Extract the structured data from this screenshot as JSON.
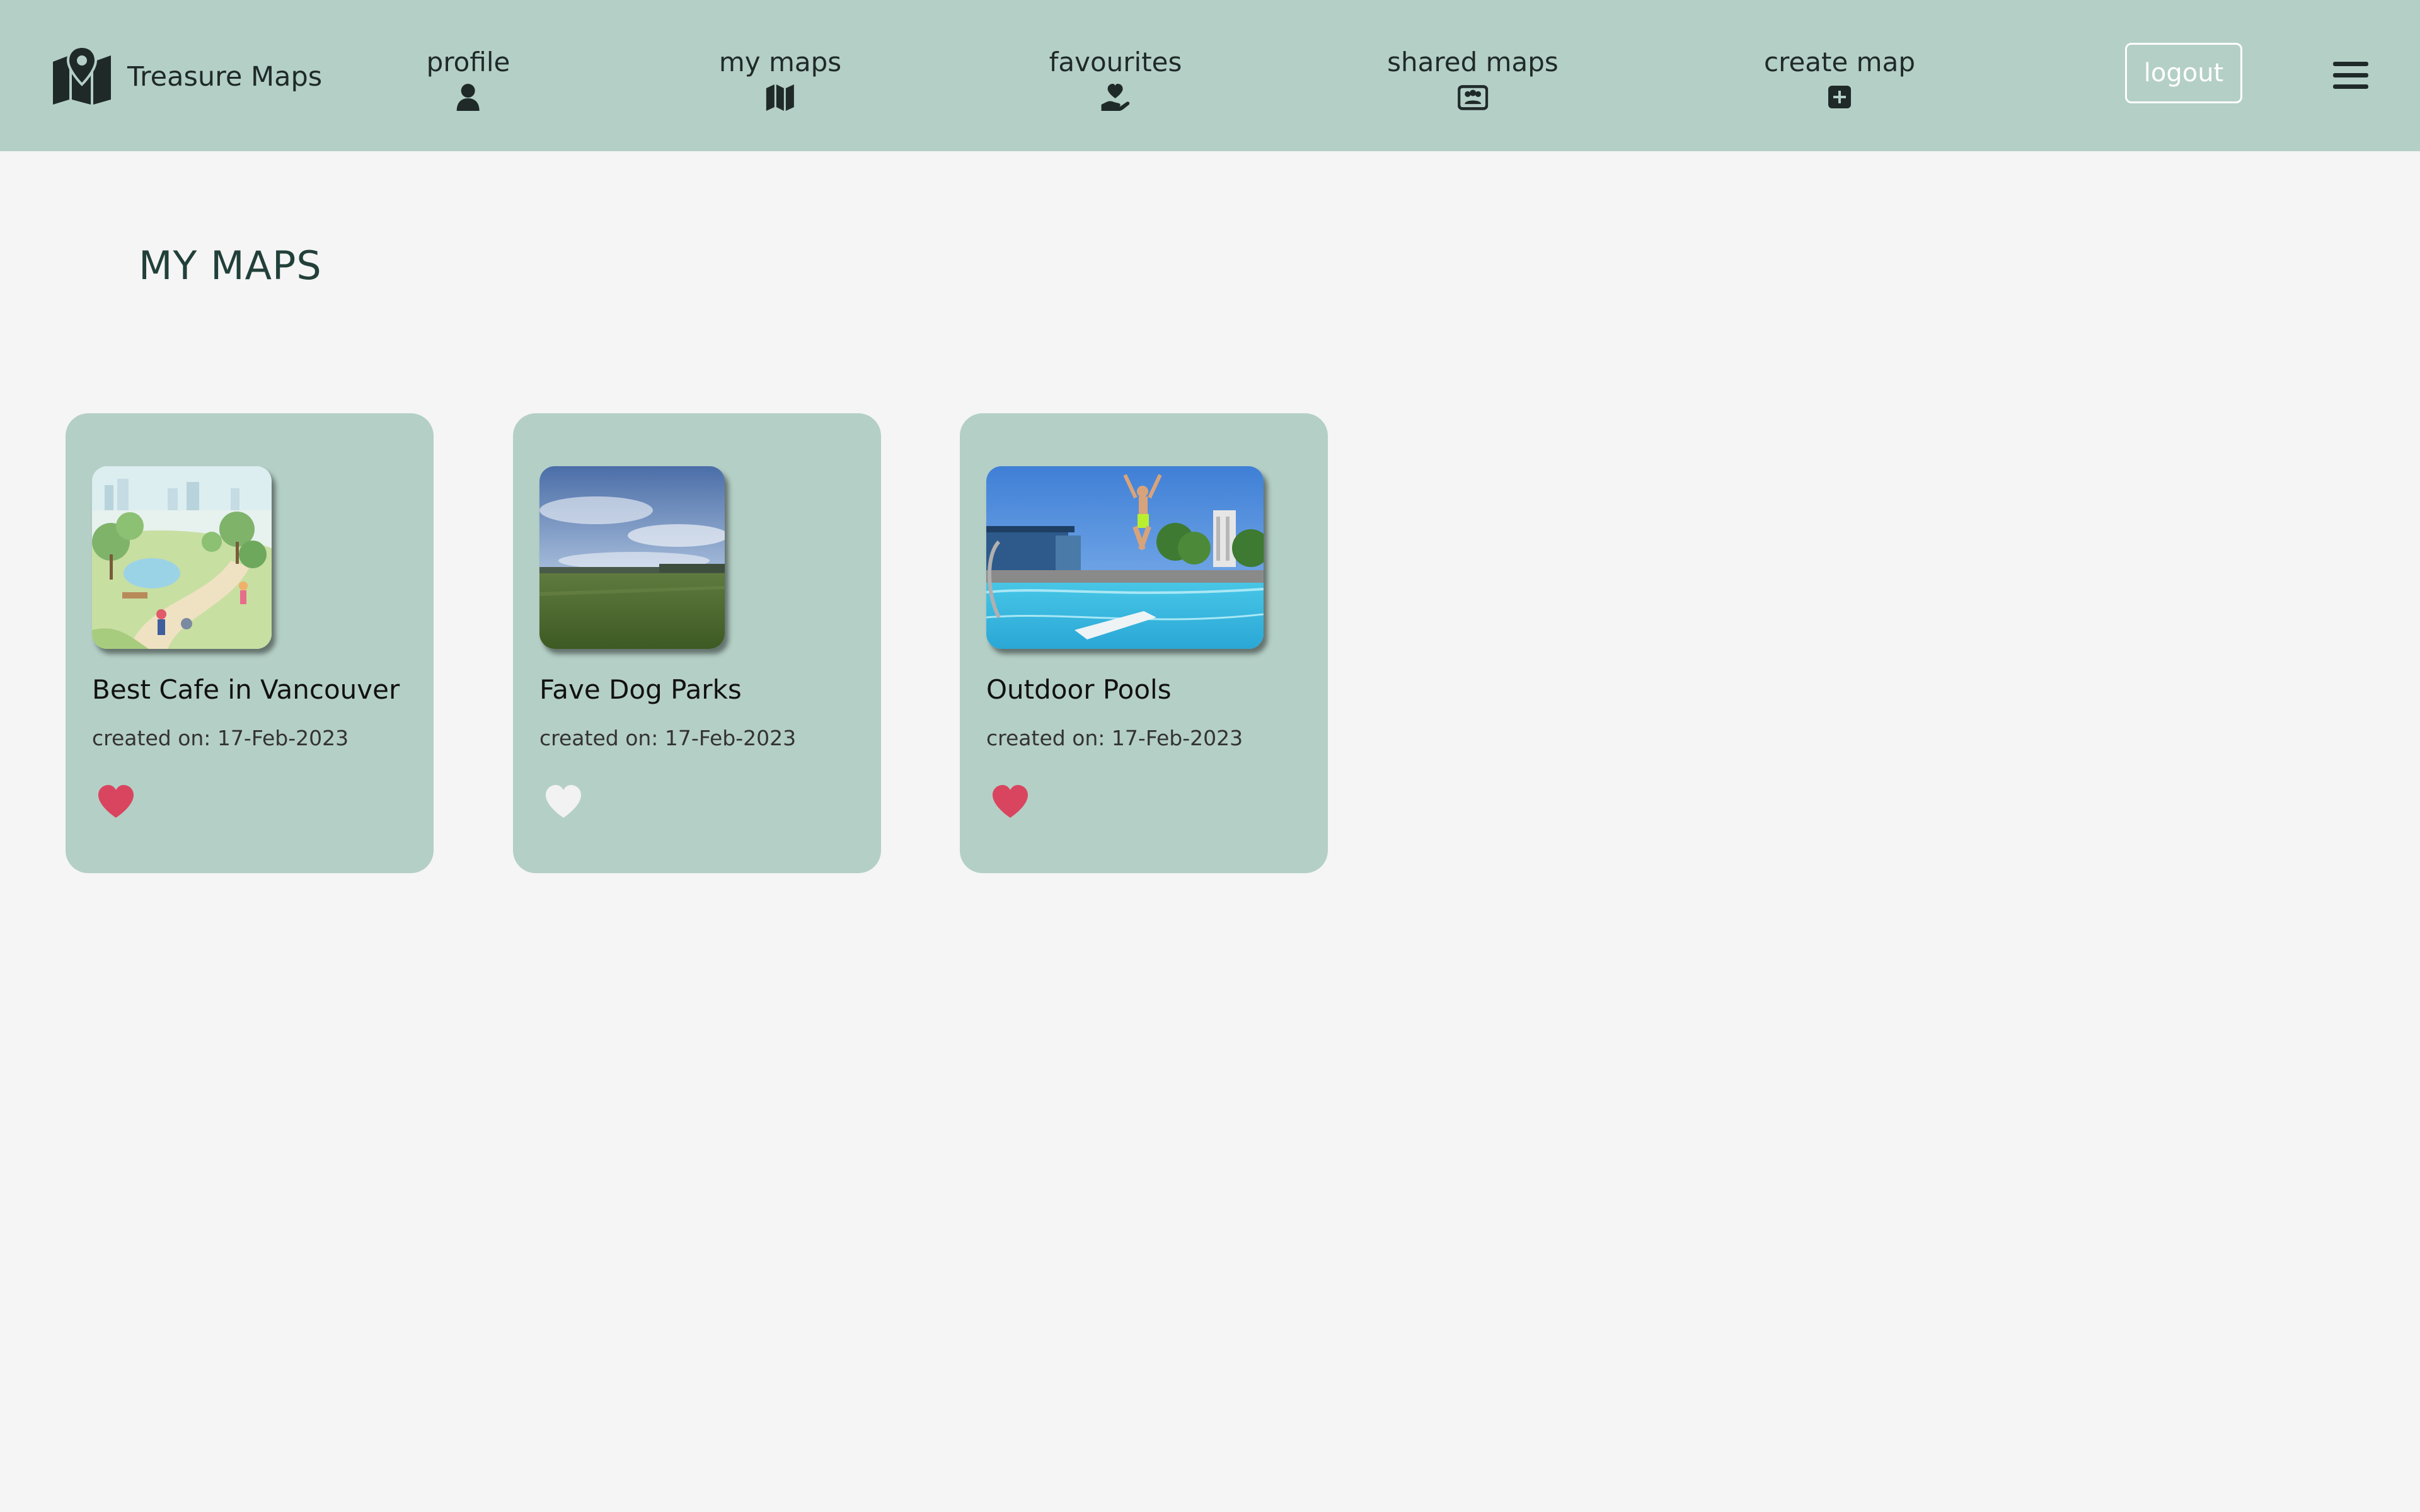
{
  "app": {
    "brand_name": "Treasure Maps",
    "brand_icon": "map-marker-icon"
  },
  "nav": {
    "items": [
      {
        "label": "profile",
        "icon": "user-icon"
      },
      {
        "label": "my maps",
        "icon": "map-icon"
      },
      {
        "label": "favourites",
        "icon": "hand-holding-heart-icon"
      },
      {
        "label": "shared maps",
        "icon": "users-card-icon"
      },
      {
        "label": "create map",
        "icon": "plus-square-icon"
      }
    ],
    "logout_label": "logout",
    "menu_icon": "hamburger-icon"
  },
  "main": {
    "page_title": "MY MAPS",
    "maps": [
      {
        "title": "Best Cafe in Vancouver",
        "created_label": "created on:",
        "created_date": "17-Feb-2023",
        "favourite": true,
        "image": "park-illustration"
      },
      {
        "title": "Fave Dog Parks",
        "created_label": "created on:",
        "created_date": "17-Feb-2023",
        "favourite": false,
        "image": "grass-field-photo"
      },
      {
        "title": "Outdoor Pools",
        "created_label": "created on:",
        "created_date": "17-Feb-2023",
        "favourite": true,
        "image": "outdoor-pool-photo"
      }
    ]
  },
  "colors": {
    "nav_background": "#b4cfc6",
    "card_background": "#b4cfc6",
    "page_background": "#f5f5f5",
    "heart_active": "#d9455f",
    "heart_inactive": "#f2f2f2",
    "title_color": "#22403a"
  }
}
